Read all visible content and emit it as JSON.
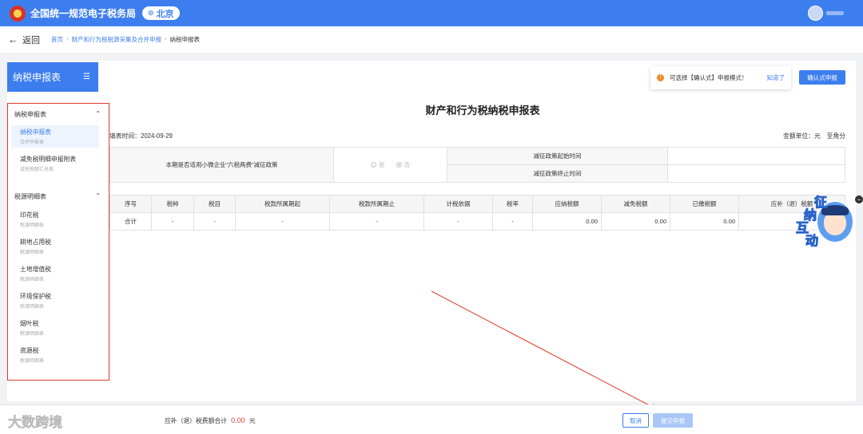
{
  "header": {
    "site_title": "全国统一规范电子税务局",
    "region": "北京"
  },
  "breadcrumb": {
    "back_label": "返回",
    "items": [
      "首页",
      "财产和行为税税源采集及合并申报",
      "纳税申报表"
    ]
  },
  "sidebar": {
    "title": "纳税申报表",
    "groups": [
      {
        "label": "纳税申报表",
        "items": [
          {
            "name": "纳税申报表",
            "sub": "合并申报表"
          },
          {
            "name": "减免税明细申报附表",
            "sub": "减免税额汇总表"
          }
        ]
      },
      {
        "label": "税源明细表",
        "items": [
          {
            "name": "印花税",
            "sub": "税源明细表"
          },
          {
            "name": "耕地占用税",
            "sub": "税源明细表"
          },
          {
            "name": "土地增值税",
            "sub": "税源明细表"
          },
          {
            "name": "环境保护税",
            "sub": "税源明细表"
          },
          {
            "name": "烟叶税",
            "sub": "税源明细表"
          },
          {
            "name": "资源税",
            "sub": "税源明细表"
          }
        ]
      }
    ]
  },
  "notice": {
    "text": "可选择【确认式】申报模式！",
    "ok": "知道了"
  },
  "confirm_button": "确认式申报",
  "form": {
    "title": "财产和行为税纳税申报表",
    "fill_date": "填表时间：2024-09-29",
    "unit": "金额单位：元　至角分",
    "policy_label": "本期是否适用小微企业“六税两费”减征政策",
    "radio_yes": "是",
    "radio_no": "否",
    "policy_start": "减征政策起始时间",
    "policy_end": "减征政策终止时间",
    "columns": [
      "序号",
      "税种",
      "税目",
      "税款所属期起",
      "税款所属期止",
      "计税依据",
      "税率",
      "应纳税额",
      "减免税额",
      "已缴税额",
      "应补（退）税额"
    ],
    "total_row": [
      "合计",
      "-",
      "-",
      "-",
      "-",
      "-",
      "-",
      "0.00",
      "0.00",
      "0.00",
      ""
    ]
  },
  "mascot": {
    "chars": [
      "征",
      "纳",
      "互",
      "动"
    ]
  },
  "footer": {
    "total_label": "应补（退）税费额合计",
    "total_value": "0.00",
    "total_unit": "元",
    "cancel": "取消",
    "submit": "提交申报",
    "watermark": "大数跨境"
  },
  "colors": {
    "primary": "#3d7eef",
    "annotation": "#e03a2f"
  }
}
